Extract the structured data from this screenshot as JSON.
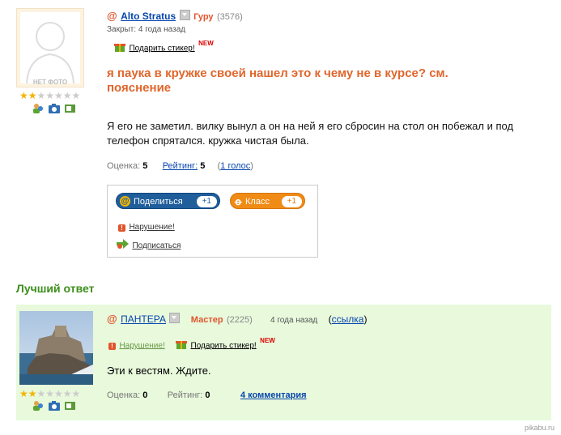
{
  "question": {
    "author": "Alto Stratus",
    "rank": "Гуру",
    "points": "(3576)",
    "closed": "Закрыт: 4 года назад",
    "gift_sticker": "Подарить стикер!",
    "new_label": "NEW",
    "no_photo": "НЕТ ФОТО",
    "title": "я паука в кружке своей нашел это к чему не в курсе? см. пояснение",
    "body": "Я его не заметил. вилку вынул а он на ней я его сбросин на стол он побежал и под телефон спрятался. кружка чистая была.",
    "rating_label": "Оценка:",
    "rating_value": "5",
    "rating_link": "Рейтинг:",
    "rating_link_value": "5",
    "votes_open": "(",
    "votes_link": "1 голос",
    "votes_close": ")",
    "stars_on": 2,
    "stars_total": 7
  },
  "sharebox": {
    "share_label": "Поделиться",
    "share_count": "+1",
    "class_label": "Класс",
    "class_count": "+1",
    "violation": "Нарушение!",
    "subscribe": "Подписаться"
  },
  "best_answer": {
    "heading": "Лучший ответ",
    "author": "ПАНТЕРА",
    "rank": "Мастер",
    "points": "(2225)",
    "time": "4 года назад",
    "link_open": "(",
    "link_label": "ссылка",
    "link_close": ")",
    "violation": "Нарушение!",
    "gift_sticker": "Подарить стикер!",
    "new_label": "NEW",
    "body": "Эти к вестям. Ждите.",
    "rating_label": "Оценка:",
    "rating_value": "0",
    "rating2_label": "Рейтинг:",
    "rating2_value": "0",
    "comments": "4 комментария",
    "stars_on": 2,
    "stars_total": 7
  },
  "watermark": "pikabu.ru",
  "colors": {
    "accent_orange": "#e0662c",
    "link": "#0645ad",
    "green_heading": "#3d8f1c",
    "answer_bg": "#e8f9dc"
  }
}
